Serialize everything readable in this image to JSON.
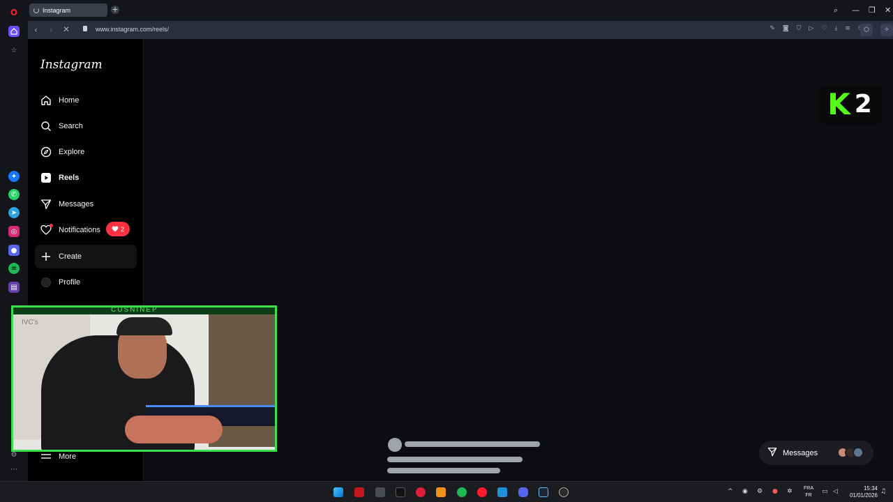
{
  "browser": {
    "tab_title": "Instagram",
    "url": "www.instagram.com/reels/"
  },
  "instagram": {
    "logo": "Instagram",
    "nav": [
      {
        "label": "Home",
        "icon": "home-icon"
      },
      {
        "label": "Search",
        "icon": "search-icon"
      },
      {
        "label": "Explore",
        "icon": "compass-icon"
      },
      {
        "label": "Reels",
        "icon": "reels-icon",
        "active": true
      },
      {
        "label": "Messages",
        "icon": "send-icon"
      },
      {
        "label": "Notifications",
        "icon": "heart-icon"
      },
      {
        "label": "Create",
        "icon": "plus-icon"
      },
      {
        "label": "Profile",
        "icon": "avatar-icon"
      }
    ],
    "notifications_count": "2",
    "more_label": "More",
    "messages_pill_label": "Messages"
  },
  "overlay": {
    "kick_number": "2",
    "webcam_title": "CUSNINEP",
    "webcam_watermark": "IVC’s"
  },
  "taskbar": {
    "lang_top": "FRA",
    "lang_bottom": "FR",
    "time": "15:34",
    "date": "01/01/2026"
  },
  "colors": {
    "accent_notification": "#ff3040",
    "kick_green": "#53fc18",
    "webcam_border": "#37e04c"
  }
}
